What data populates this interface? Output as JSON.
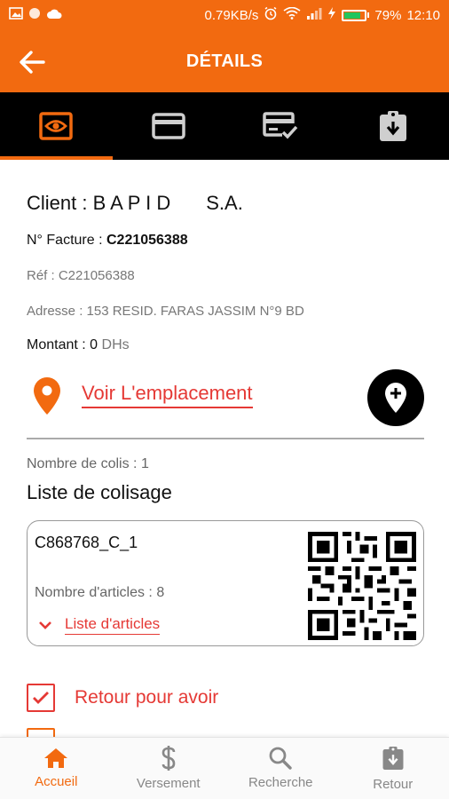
{
  "status_bar": {
    "speed": "0.79KB/s",
    "battery": "79%",
    "battery_level": 0.79,
    "time": "12:10"
  },
  "app_bar": {
    "title": "DÉTAILS",
    "back_icon": "arrow-left-icon"
  },
  "tabs": [
    {
      "icon": "eye-icon",
      "active": true
    },
    {
      "icon": "credit-card-icon",
      "active": false
    },
    {
      "icon": "payment-check-icon",
      "active": false
    },
    {
      "icon": "clipboard-download-icon",
      "active": false
    }
  ],
  "details": {
    "client_label": "Client : B A P I D",
    "client_suffix": "S.A.",
    "facture_label": "N° Facture : ",
    "facture_value": "C221056388",
    "ref": "Réf : C221056388",
    "adresse": "Adresse : 153 RESID. FARAS JASSIM N°9 BD",
    "montant_label": "Montant : ",
    "montant_value": "0",
    "montant_unit": " DHs",
    "location_link": "Voir L'emplacement",
    "colis_count": "Nombre de colis : 1",
    "colisage_title": "Liste de colisage"
  },
  "package": {
    "code": "C868768_C_1",
    "articles_count": "Nombre d'articles : 8",
    "articles_link": "Liste d'articles"
  },
  "options": {
    "retour_avoir": "Retour pour avoir",
    "retour_avoir_checked": true
  },
  "bottom_nav": [
    {
      "label": "Accueil",
      "icon": "home-icon",
      "active": true
    },
    {
      "label": "Versement",
      "icon": "dollar-icon",
      "active": false
    },
    {
      "label": "Recherche",
      "icon": "search-icon",
      "active": false
    },
    {
      "label": "Retour",
      "icon": "clipboard-download-icon",
      "active": false
    }
  ],
  "colors": {
    "accent": "#f26a10",
    "link_red": "#e53935"
  }
}
